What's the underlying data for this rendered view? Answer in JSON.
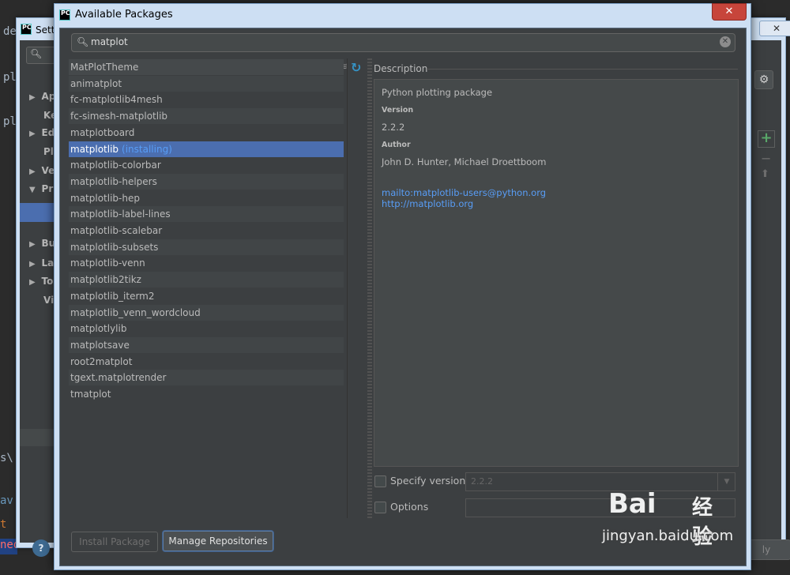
{
  "background": {
    "code_lines": [
      "de",
      "pl",
      "pl",
      "s\\",
      "av",
      "t",
      "ned"
    ],
    "settings_title": "Setti",
    "settings_close": "✕",
    "tree_items": [
      {
        "label": "Ap",
        "arrow": "▶"
      },
      {
        "label": "Ke",
        "arrow": ""
      },
      {
        "label": "Ed",
        "arrow": "▶"
      },
      {
        "label": "Pl",
        "arrow": ""
      },
      {
        "label": "Ve",
        "arrow": "▶"
      },
      {
        "label": "Pr",
        "arrow": "▼"
      },
      {
        "label": "Bu",
        "arrow": "▶"
      },
      {
        "label": "La",
        "arrow": "▶"
      },
      {
        "label": "To",
        "arrow": "▶"
      },
      {
        "label": "Vi",
        "arrow": ""
      }
    ],
    "help_label": "?",
    "apply_label": "ly",
    "gear_icon": "⚙",
    "plus_icon": "+",
    "minus_icon": "−",
    "up_icon": "⬆"
  },
  "dialog": {
    "logo": "PC",
    "title": "Available Packages",
    "close_icon": "✕",
    "search": {
      "value": "matplot",
      "icon": "🔍︎"
    },
    "packages": [
      {
        "name": "MatPlotTheme",
        "status": ""
      },
      {
        "name": "animatplot",
        "status": ""
      },
      {
        "name": "fc-matplotlib4mesh",
        "status": ""
      },
      {
        "name": "fc-simesh-matplotlib",
        "status": ""
      },
      {
        "name": "matplotboard",
        "status": ""
      },
      {
        "name": "matplotlib",
        "status": "(installing)"
      },
      {
        "name": "matplotlib-colorbar",
        "status": ""
      },
      {
        "name": "matplotlib-helpers",
        "status": ""
      },
      {
        "name": "matplotlib-hep",
        "status": ""
      },
      {
        "name": "matplotlib-label-lines",
        "status": ""
      },
      {
        "name": "matplotlib-scalebar",
        "status": ""
      },
      {
        "name": "matplotlib-subsets",
        "status": ""
      },
      {
        "name": "matplotlib-venn",
        "status": ""
      },
      {
        "name": "matplotlib2tikz",
        "status": ""
      },
      {
        "name": "matplotlib_iterm2",
        "status": ""
      },
      {
        "name": "matplotlib_venn_wordcloud",
        "status": ""
      },
      {
        "name": "matplotlylib",
        "status": ""
      },
      {
        "name": "matplotsave",
        "status": ""
      },
      {
        "name": "root2matplot",
        "status": ""
      },
      {
        "name": "tgext.matplotrender",
        "status": ""
      },
      {
        "name": "tmatplot",
        "status": ""
      }
    ],
    "selected_index": 5,
    "description": {
      "label": "Description",
      "summary": "Python plotting package",
      "version_label": "Version",
      "version": "2.2.2",
      "author_label": "Author",
      "author": "John D. Hunter, Michael Droettboom",
      "links": [
        "mailto:matplotlib-users@python.org",
        "http://matplotlib.org"
      ]
    },
    "specify_version": {
      "label": "Specify version",
      "value": "2.2.2"
    },
    "options": {
      "label": "Options",
      "value": ""
    },
    "buttons": {
      "install": "Install Package",
      "manage": "Manage Repositories"
    }
  },
  "watermark": {
    "brand": "Bai",
    "cn": "经验",
    "url": "jingyan.baidu.com"
  }
}
